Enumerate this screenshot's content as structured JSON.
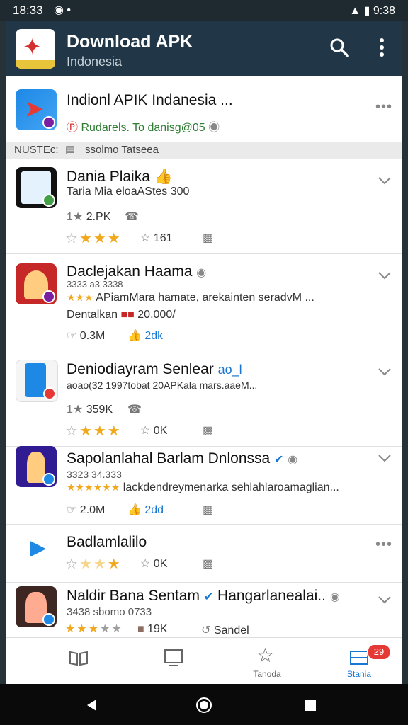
{
  "status_bar": {
    "time": "18:33",
    "right_text": "9:38"
  },
  "app_bar": {
    "title": "Download APK",
    "subtitle": "Indonesia"
  },
  "top_item": {
    "title": "Indionl APIK Indanesia ...",
    "subtitle": "Rudarels. To danisg@05"
  },
  "section": {
    "label": "NUSTEc:",
    "text": "ssolmo Tatseea"
  },
  "feed": [
    {
      "title": "Dania Plaika",
      "line1": "Taria Mia eloaAStes 300",
      "stat1": "2.PK",
      "rating_count": "161"
    },
    {
      "title": "Daclejakan Haama",
      "line1": "3333 a3 3338",
      "line2": "APiamMara hamate, arekainten seradvM ...",
      "line3": "Dentalkan",
      "line3b": "20.000/",
      "likes": "0.3M",
      "likes2": "2dk"
    },
    {
      "title": "Deniodiayram Senlear",
      "suffix": "ao_l",
      "line1": "aoao(32 1997tobat 20APKala mars.aaeM...",
      "stat1": "359K",
      "rating_count": "0K"
    },
    {
      "title": "Sapolanlahal Barlam Dnlonssa",
      "line1": "3323 34.333",
      "line2": "lackdendreymenarka sehlahlaroamaglian...",
      "likes": "2.0M",
      "likes2": "2dd"
    },
    {
      "title": "Badlamlalilo",
      "rating_count": "0K"
    },
    {
      "title": "Naldir Bana Sentam",
      "title2": "Hangarlanealai..",
      "line1": "3438 sbomo 0733",
      "stat1": "19K",
      "stat2": "Sandel"
    }
  ],
  "bottom_nav": [
    {
      "label": ""
    },
    {
      "label": ""
    },
    {
      "label": "Tanoda"
    },
    {
      "label": "Stania",
      "badge": "29"
    }
  ],
  "colors": {
    "app_bar": "#213646",
    "star": "#f0a81c",
    "like_blue": "#1976d2",
    "badge_red": "#e53935"
  }
}
